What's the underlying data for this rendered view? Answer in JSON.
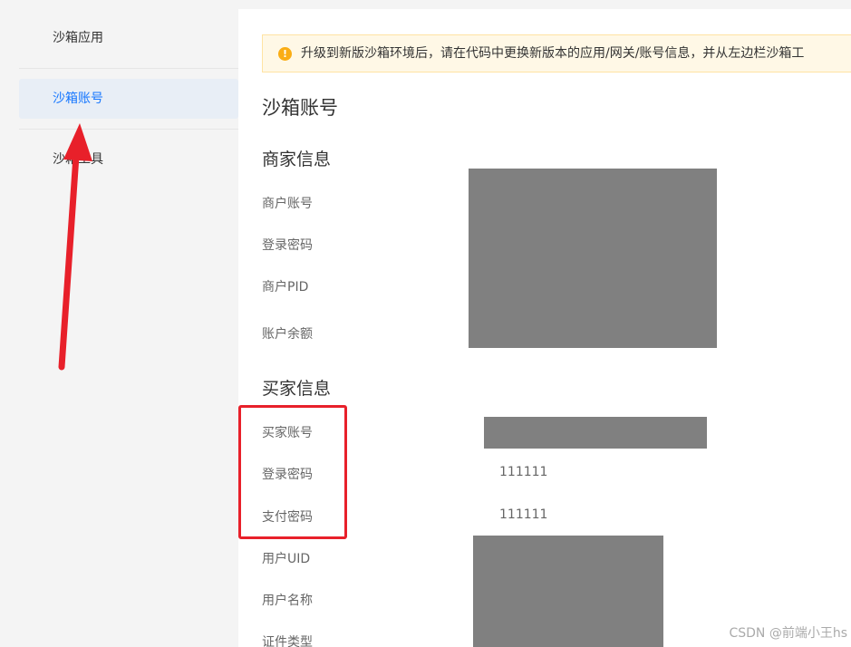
{
  "sidebar": {
    "items": [
      {
        "label": "沙箱应用"
      },
      {
        "label": "沙箱账号"
      },
      {
        "label": "沙箱工具"
      }
    ],
    "active_color": "#1677ff"
  },
  "alert": {
    "text": "升级到新版沙箱环境后，请在代码中更换新版本的应用/网关/账号信息，并从左边栏沙箱工"
  },
  "page": {
    "title": "沙箱账号"
  },
  "merchant": {
    "title": "商家信息",
    "labels": [
      "商户账号",
      "登录密码",
      "商户PID",
      "账户余额"
    ]
  },
  "buyer": {
    "title": "买家信息",
    "labels": [
      "买家账号",
      "登录密码",
      "支付密码",
      "用户UID",
      "用户名称",
      "证件类型"
    ],
    "login_password": "111111",
    "pay_password": "111111"
  },
  "annotation": {
    "arrow_color": "#e8202a"
  },
  "watermark": "CSDN @前端小王hs"
}
